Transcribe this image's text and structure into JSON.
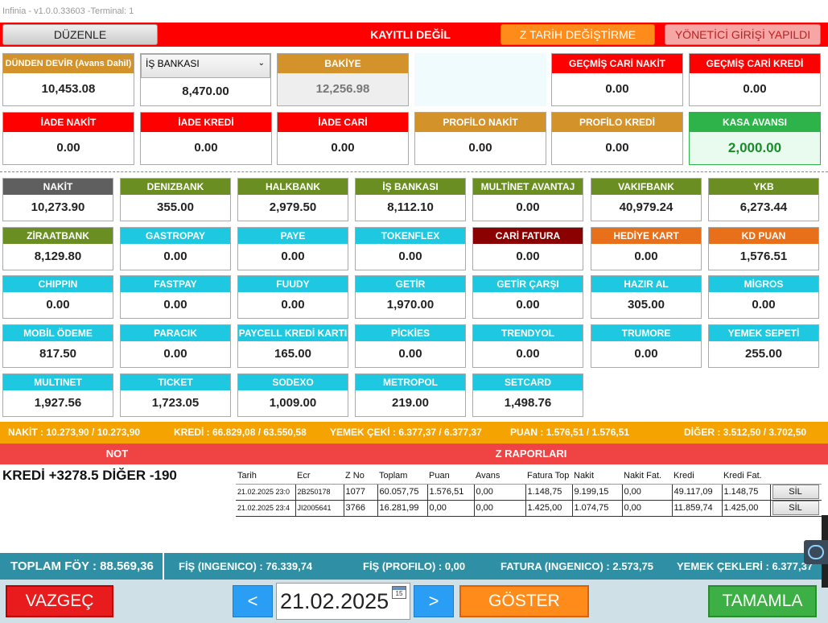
{
  "window": {
    "title": "Infinia - v1.0.0.33603 -Terminal: 1"
  },
  "topbar": {
    "duzenle_label": "DÜZENLE",
    "status_text": "KAYITLI DEĞİL",
    "ztarih_label": "Z TARİH DEĞİŞTİRME",
    "yonetici_label": "YÖNETİCİ GİRİŞİ YAPILDI"
  },
  "top_fields": {
    "dunden_devir": {
      "label": "DÜNDEN DEVİR (Avans Dahil)",
      "value": "10,453.08"
    },
    "bank_select": {
      "selected": "İŞ BANKASI",
      "value": "8,470.00"
    },
    "bakiye": {
      "label": "BAKİYE",
      "value": "12,256.98"
    },
    "gecmis_cari_nakit": {
      "label": "GEÇMİŞ CARİ NAKİT",
      "value": "0.00"
    },
    "gecmis_cari_kredi": {
      "label": "GEÇMİŞ CARİ KREDİ",
      "value": "0.00"
    },
    "iade_nakit": {
      "label": "İADE NAKİT",
      "value": "0.00"
    },
    "iade_kredi": {
      "label": "İADE KREDİ",
      "value": "0.00"
    },
    "iade_cari": {
      "label": "İADE CARİ",
      "value": "0.00"
    },
    "profilo_nakit": {
      "label": "PROFİLO NAKİT",
      "value": "0.00"
    },
    "profilo_kredi": {
      "label": "PROFİLO KREDİ",
      "value": "0.00"
    },
    "kasa_avansi": {
      "label": "KASA AVANSI",
      "value": "2,000.00"
    }
  },
  "tiles": [
    {
      "label": "NAKİT",
      "value": "10,273.90",
      "color": "#5f5f5f"
    },
    {
      "label": "DENIZBANK",
      "value": "355.00",
      "color": "#6b8e23"
    },
    {
      "label": "HALKBANK",
      "value": "2,979.50",
      "color": "#6b8e23"
    },
    {
      "label": "İŞ BANKASI",
      "value": "8,112.10",
      "color": "#6b8e23"
    },
    {
      "label": "MULTİNET AVANTAJ",
      "value": "0.00",
      "color": "#6b8e23"
    },
    {
      "label": "VAKIFBANK",
      "value": "40,979.24",
      "color": "#6b8e23"
    },
    {
      "label": "YKB",
      "value": "6,273.44",
      "color": "#6b8e23"
    },
    {
      "label": "ZİRAATBANK",
      "value": "8,129.80",
      "color": "#6b8e23"
    },
    {
      "label": "GASTROPAY",
      "value": "0.00",
      "color": "#1ec8e0"
    },
    {
      "label": "PAYE",
      "value": "0.00",
      "color": "#1ec8e0"
    },
    {
      "label": "TOKENFLEX",
      "value": "0.00",
      "color": "#1ec8e0"
    },
    {
      "label": "CARİ FATURA",
      "value": "0.00",
      "color": "#8b0000"
    },
    {
      "label": "HEDİYE KART",
      "value": "0.00",
      "color": "#e8701a"
    },
    {
      "label": "KD PUAN",
      "value": "1,576.51",
      "color": "#e8701a"
    },
    {
      "label": "CHIPPIN",
      "value": "0.00",
      "color": "#1ec8e0"
    },
    {
      "label": "FASTPAY",
      "value": "0.00",
      "color": "#1ec8e0"
    },
    {
      "label": "FUUDY",
      "value": "0.00",
      "color": "#1ec8e0"
    },
    {
      "label": "GETİR",
      "value": "1,970.00",
      "color": "#1ec8e0"
    },
    {
      "label": "GETİR ÇARŞI",
      "value": "0.00",
      "color": "#1ec8e0"
    },
    {
      "label": "HAZIR AL",
      "value": "305.00",
      "color": "#1ec8e0"
    },
    {
      "label": "MİGROS",
      "value": "0.00",
      "color": "#1ec8e0"
    },
    {
      "label": "MOBİL ÖDEME",
      "value": "817.50",
      "color": "#1ec8e0"
    },
    {
      "label": "PARACIK",
      "value": "0.00",
      "color": "#1ec8e0"
    },
    {
      "label": "PAYCELL KREDİ KARTI",
      "value": "165.00",
      "color": "#1ec8e0"
    },
    {
      "label": "PİCKİES",
      "value": "0.00",
      "color": "#1ec8e0"
    },
    {
      "label": "TRENDYOL",
      "value": "0.00",
      "color": "#1ec8e0"
    },
    {
      "label": "TRUMORE",
      "value": "0.00",
      "color": "#1ec8e0"
    },
    {
      "label": "YEMEK SEPETİ",
      "value": "255.00",
      "color": "#1ec8e0"
    },
    {
      "label": "MULTINET",
      "value": "1,927.56",
      "color": "#1ec8e0"
    },
    {
      "label": "TICKET",
      "value": "1,723.05",
      "color": "#1ec8e0"
    },
    {
      "label": "SODEXO",
      "value": "1,009.00",
      "color": "#1ec8e0"
    },
    {
      "label": "METROPOL",
      "value": "219.00",
      "color": "#1ec8e0"
    },
    {
      "label": "SETCARD",
      "value": "1,498.76",
      "color": "#1ec8e0"
    }
  ],
  "summary": {
    "nakit": "NAKİT : 10.273,90 / 10.273,90",
    "kredi": "KREDİ : 66.829,08 / 63.550,58",
    "yemek_ceki": "YEMEK ÇEKİ : 6.377,37 / 6.377,37",
    "puan": "PUAN : 1.576,51 / 1.576,51",
    "diger": "DİĞER : 3.512,50 / 3.702,50"
  },
  "not": {
    "header": "NOT",
    "text": "KREDİ +3278.5 DİĞER -190"
  },
  "z_raporlari": {
    "header": "Z RAPORLARI",
    "columns": [
      "Tarih",
      "Ecr",
      "Z No",
      "Toplam",
      "Puan",
      "Avans",
      "Fatura Top",
      "Nakit",
      "Nakit Fat.",
      "Kredi",
      "Kredi Fat."
    ],
    "rows": [
      {
        "cells": [
          "21.02.2025 23:0",
          "2B250178",
          "1077",
          "60.057,75",
          "1.576,51",
          "0,00",
          "1.148,75",
          "9.199,15",
          "0,00",
          "49.117,09",
          "1.148,75"
        ],
        "action": "SİL"
      },
      {
        "cells": [
          "21.02.2025 23:4",
          "JI2005641",
          "3766",
          "16.281,99",
          "0,00",
          "0,00",
          "1.425,00",
          "1.074,75",
          "0,00",
          "11.859,74",
          "1.425,00"
        ],
        "action": "SİL"
      }
    ]
  },
  "totals": {
    "toplam_foy": "TOPLAM FÖY : 88.569,36",
    "fis_ingenico": "FİŞ (INGENICO) : 76.339,74",
    "fis_profilo": "FİŞ (PROFILO) : 0,00",
    "fatura_ingenico": "FATURA (INGENICO) : 2.573,75",
    "yemek_cekleri": "YEMEK ÇEKLERİ : 6.377,37"
  },
  "bottom": {
    "vazgec_label": "VAZGEÇ",
    "prev_label": "<",
    "date_value": "21.02.2025",
    "calendar_day": "15",
    "next_label": ">",
    "goster_label": "GÖSTER",
    "tamamla_label": "TAMAMLA"
  },
  "colors": {
    "red": "#ff0000",
    "orange_header": "#d4922a",
    "green_header": "#2db34a",
    "summary_bar": "#f5a300",
    "totals_bar": "#2e8fa5"
  }
}
